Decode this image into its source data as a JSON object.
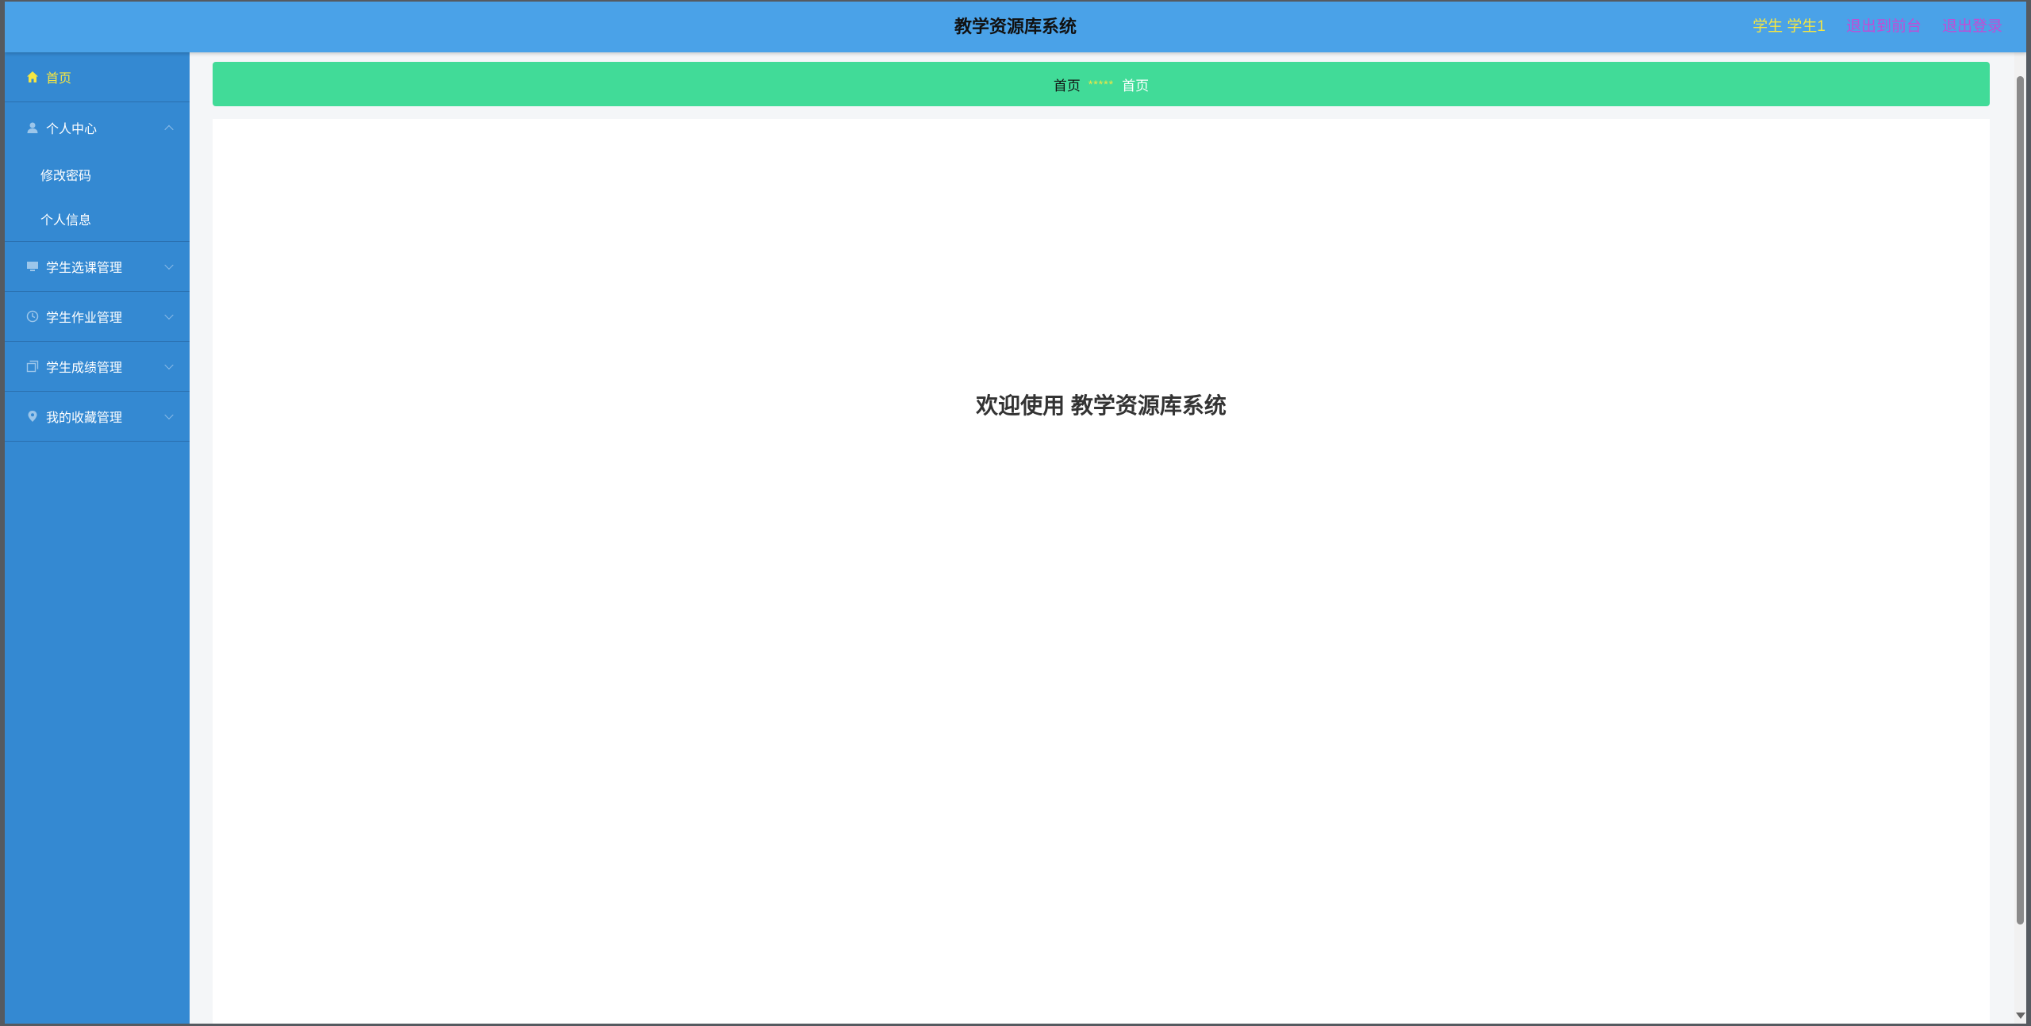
{
  "header": {
    "title": "教学资源库系统",
    "user_label": "学生 学生1",
    "back_label": "退出到前台",
    "logout_label": "退出登录"
  },
  "sidebar": {
    "home": {
      "label": "首页",
      "icon": "home-icon"
    },
    "personal": {
      "label": "个人中心",
      "icon": "user-icon",
      "children": [
        "修改密码",
        "个人信息"
      ]
    },
    "items": [
      {
        "label": "学生选课管理",
        "icon": "monitor-icon"
      },
      {
        "label": "学生作业管理",
        "icon": "clock-icon"
      },
      {
        "label": "学生成绩管理",
        "icon": "copy-icon"
      },
      {
        "label": "我的收藏管理",
        "icon": "location-icon"
      }
    ]
  },
  "breadcrumb": {
    "home": "首页",
    "separator": "*****",
    "current": "首页"
  },
  "main": {
    "welcome": "欢迎使用 教学资源库系统"
  },
  "colors": {
    "topbar": "#4aa2e8",
    "sidebar": "#3489d2",
    "breadcrumb": "#41db98",
    "highlight": "#f5e642",
    "link": "#c04dd6"
  }
}
